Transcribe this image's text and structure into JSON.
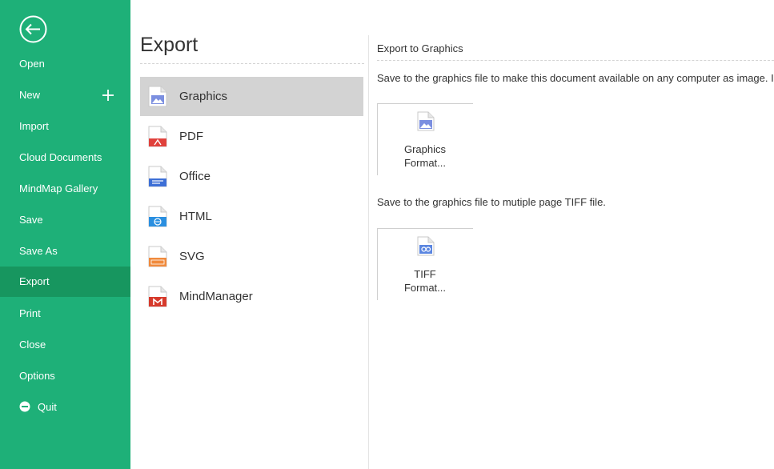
{
  "sidebar": {
    "items": [
      {
        "label": "Open"
      },
      {
        "label": "New"
      },
      {
        "label": "Import"
      },
      {
        "label": "Cloud Documents"
      },
      {
        "label": "MindMap Gallery"
      },
      {
        "label": "Save"
      },
      {
        "label": "Save As"
      },
      {
        "label": "Export"
      },
      {
        "label": "Print"
      },
      {
        "label": "Close"
      },
      {
        "label": "Options"
      },
      {
        "label": "Quit"
      }
    ],
    "active": "Export",
    "bg_color": "#1eb078",
    "active_color": "#17965f"
  },
  "export_panel": {
    "title": "Export",
    "formats": [
      {
        "label": "Graphics",
        "icon": "graphics-file-icon"
      },
      {
        "label": "PDF",
        "icon": "pdf-file-icon"
      },
      {
        "label": "Office",
        "icon": "office-file-icon"
      },
      {
        "label": "HTML",
        "icon": "html-file-icon"
      },
      {
        "label": "SVG",
        "icon": "svg-file-icon"
      },
      {
        "label": "MindManager",
        "icon": "mindmanager-file-icon"
      }
    ],
    "selected": "Graphics"
  },
  "detail": {
    "title": "Export to Graphics",
    "desc1": "Save to the graphics file to make this document available on any computer as image.  I",
    "desc2": "Save to the graphics file to mutiple page TIFF file.",
    "tiles": [
      {
        "line1": "Graphics",
        "line2": "Format...",
        "icon": "image-file-icon"
      },
      {
        "line1": "TIFF",
        "line2": "Format...",
        "icon": "tiff-file-icon"
      }
    ]
  }
}
